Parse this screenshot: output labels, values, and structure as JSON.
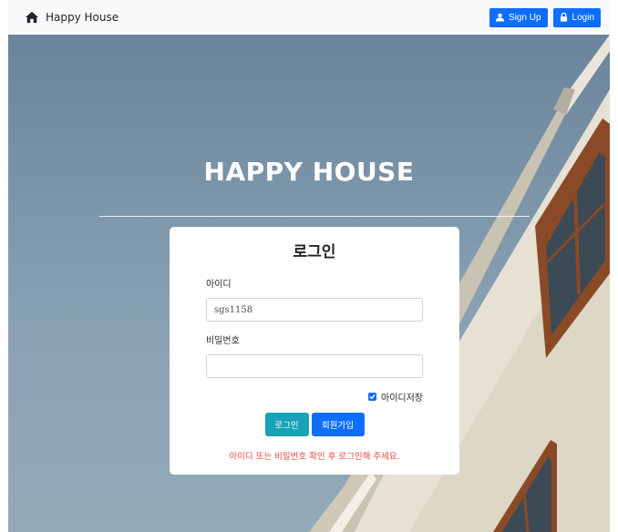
{
  "navbar": {
    "brand": "Happy House",
    "signup_label": "Sign Up",
    "login_label": "Login"
  },
  "hero": {
    "title": "HAPPY HOUSE"
  },
  "login_form": {
    "title": "로그인",
    "id_label": "아이디",
    "id_value": "sgs1158",
    "password_label": "비밀번호",
    "password_value": "",
    "remember_label": "아이디저장",
    "remember_checked": true,
    "login_button": "로그인",
    "signup_button": "회원가입",
    "error_message": "아이디 또는 비밀번호 확인 후 로그인해 주세요."
  },
  "colors": {
    "primary": "#0d6efd",
    "info": "#17a2b8",
    "danger": "#e74c3c",
    "navbar_bg": "#f8f9fa"
  }
}
